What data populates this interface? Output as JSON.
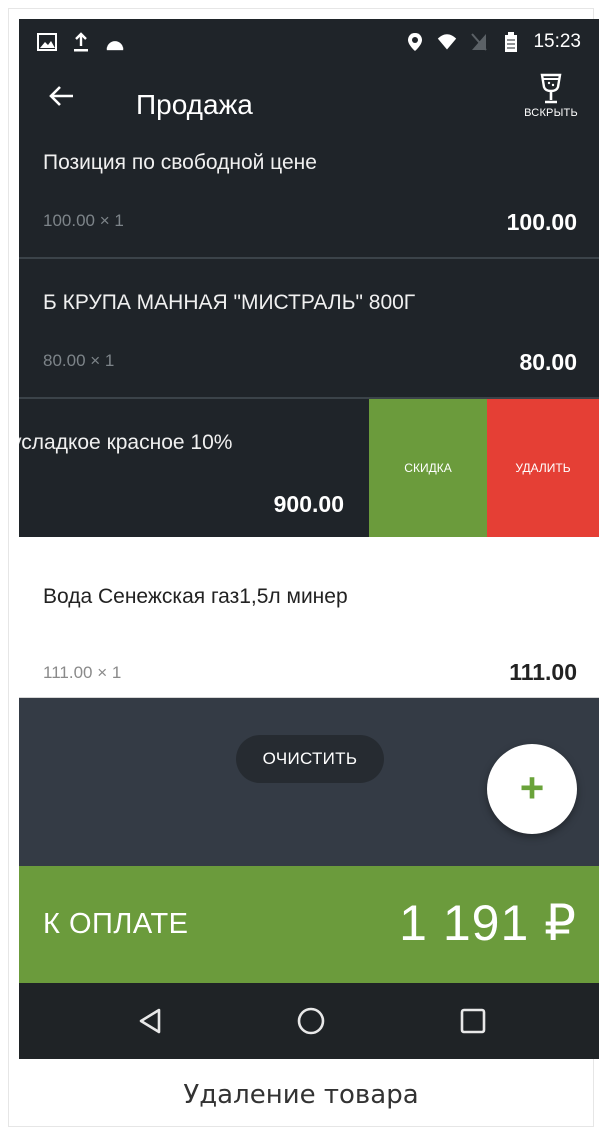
{
  "status_bar": {
    "time": "15:23",
    "left_icons": [
      "image-icon",
      "upload-icon",
      "android-icon"
    ],
    "right_icons": [
      "location-icon",
      "wifi-icon",
      "no-sim-icon",
      "battery-icon"
    ]
  },
  "header": {
    "title": "Продажа",
    "back_icon": "arrow-left-icon",
    "open_button": {
      "label": "ВСКРЫТЬ",
      "icon": "glass-icon"
    }
  },
  "items": [
    {
      "name": "Позиция по свободной цене",
      "qty": "100.00 × 1",
      "total": "100.00"
    },
    {
      "name": "Б КРУПА МАННАЯ \"МИСТРАЛЬ\"  800Г",
      "qty": "80.00 × 1",
      "total": "80.00"
    },
    {
      "name": "усладкое красное 10%",
      "qty": "",
      "total": "900.00"
    },
    {
      "name": "Вода Сенежская газ1,5л минер",
      "qty": "111.00 × 1",
      "total": "111.00"
    }
  ],
  "swipe_actions": {
    "discount_label": "СКИДКА",
    "delete_label": "УДАЛИТЬ"
  },
  "clear_label": "ОЧИСТИТЬ",
  "fab_label": "+",
  "payment": {
    "label": "К ОПЛАТЕ",
    "amount": "1 191 ₽"
  },
  "colors": {
    "background_dark": "#1f2429",
    "accent_green": "#6b9b3c",
    "delete_red": "#e53f35",
    "empty_area": "#343b45"
  },
  "caption": "Удаление товара"
}
